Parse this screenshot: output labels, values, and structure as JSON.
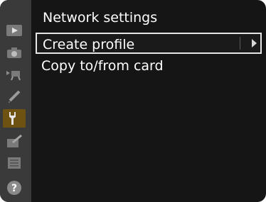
{
  "title": "Network settings",
  "menu": [
    {
      "label": "Create profile",
      "selected": true,
      "has_submenu": true
    },
    {
      "label": "Copy to/from card",
      "selected": false,
      "has_submenu": false
    }
  ],
  "sidebar": [
    {
      "icon": "playback-icon"
    },
    {
      "icon": "camera-icon"
    },
    {
      "icon": "movie-icon"
    },
    {
      "icon": "pencil-icon"
    },
    {
      "icon": "wrench-icon",
      "active": true
    },
    {
      "icon": "retouch-icon"
    },
    {
      "icon": "my-menu-icon"
    },
    {
      "icon": "help-icon",
      "label": "?"
    }
  ],
  "colors": {
    "background": "#151515",
    "sidebar": "#3a3a3a",
    "active_tab": "#6d5212",
    "text": "#ffffff"
  }
}
